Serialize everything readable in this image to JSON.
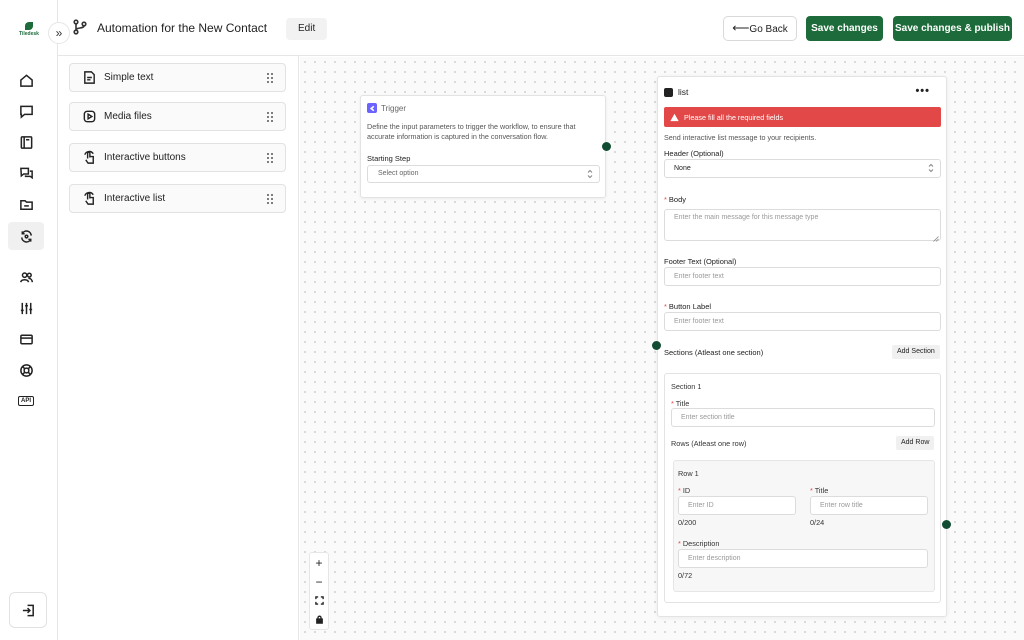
{
  "app": {
    "logo_text": "Tiledesk"
  },
  "header": {
    "title": "Automation for the New Contact",
    "edit_label": "Edit",
    "go_back_label": "Go Back",
    "save_label": "Save changes",
    "publish_label": "Save changes & publish"
  },
  "sidebar": {
    "icons": [
      "home-icon",
      "chat-icon",
      "book-icon",
      "conversations-icon",
      "folder-icon",
      "automation-icon",
      "contacts-icon",
      "settings-sliders-icon",
      "billing-card-icon",
      "support-lifebuoy-icon",
      "api-icon"
    ],
    "api_label": "API",
    "active": "automation-icon",
    "bottom_icon": "logout-icon"
  },
  "palette": {
    "blocks": [
      {
        "label": "Simple text",
        "icon": "text-message-icon"
      },
      {
        "label": "Media files",
        "icon": "media-icon"
      },
      {
        "label": "Interactive buttons",
        "icon": "tap-icon"
      },
      {
        "label": "Interactive list",
        "icon": "tap-icon"
      }
    ]
  },
  "trigger": {
    "name": "Trigger",
    "description": "Define the input parameters to trigger the workflow, to ensure that accurate information is captured in the conversation flow.",
    "starting_step_label": "Starting Step",
    "starting_step_value": "Select option"
  },
  "list_node": {
    "name": "list",
    "error": "Please fill all the required fields",
    "subtitle": "Send interactive list message to your recipients.",
    "header_label": "Header (Optional)",
    "header_value": "None",
    "body_label": "Body",
    "body_placeholder": "Enter the main message for this message type",
    "footer_label": "Footer Text (Optional)",
    "footer_placeholder": "Enter footer text",
    "button_label": "Button Label",
    "button_placeholder": "Enter footer text",
    "sections_label": "Sections (Atleast one section)",
    "add_section_label": "Add Section",
    "section": {
      "title": "Section 1",
      "title_label": "Title",
      "title_placeholder": "Enter section title",
      "rows_label": "Rows (Atleast one row)",
      "add_row_label": "Add Row",
      "row": {
        "title": "Row 1",
        "id_label": "ID",
        "id_placeholder": "Enter ID",
        "id_counter": "0/200",
        "row_title_label": "Title",
        "row_title_placeholder": "Enter row title",
        "row_title_counter": "0/24",
        "description_label": "Description",
        "description_placeholder": "Enter description",
        "description_counter": "0/72"
      }
    }
  },
  "colors": {
    "brand_green": "#1d6b3a",
    "error_red": "#e24848",
    "handle": "#124d33",
    "trigger_accent": "#6c63ff"
  }
}
